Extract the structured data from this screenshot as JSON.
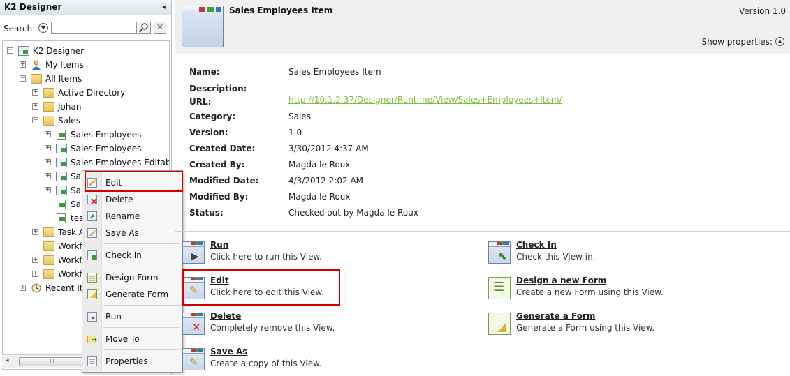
{
  "left": {
    "title": "K2 Designer",
    "collapse_glyph": "◂",
    "search_label": "Search:",
    "search_value": "",
    "search_placeholder": "",
    "clear_glyph": "✕",
    "tree": [
      {
        "label": "K2 Designer",
        "icon": "k2-designer-icon",
        "expander": "⊟"
      },
      {
        "label": "My Items",
        "icon": "user-icon",
        "expander": "+"
      },
      {
        "label": "All Items",
        "icon": "folder-open-icon",
        "expander": "−"
      },
      {
        "label": "Active Directory",
        "icon": "folder-icon",
        "expander": "+"
      },
      {
        "label": "Johan",
        "icon": "folder-icon",
        "expander": "+"
      },
      {
        "label": "Sales",
        "icon": "folder-open-icon",
        "expander": "−"
      },
      {
        "label": "Sales Employees",
        "icon": "smartobject-icon",
        "expander": "+"
      },
      {
        "label": "Sales Employees",
        "icon": "view-icon",
        "expander": "+"
      },
      {
        "label": "Sales Employees Editabl",
        "icon": "view-icon",
        "expander": "+"
      },
      {
        "label": "Sa",
        "icon": "view-icon",
        "expander": "+"
      },
      {
        "label": "Sa",
        "icon": "view-icon",
        "expander": "+"
      },
      {
        "label": "Sa",
        "icon": "document-icon",
        "expander": ""
      },
      {
        "label": "tes",
        "icon": "document-icon",
        "expander": ""
      },
      {
        "label": "Task A",
        "icon": "folder-icon",
        "expander": "+"
      },
      {
        "label": "Workf",
        "icon": "folder-icon",
        "expander": ""
      },
      {
        "label": "Workf",
        "icon": "folder-icon",
        "expander": "+"
      },
      {
        "label": "Workf",
        "icon": "folder-icon",
        "expander": "+"
      },
      {
        "label": "Recent It",
        "icon": "recent-icon",
        "expander": "+"
      }
    ],
    "scroll_arrow": "◂",
    "scroll_grip": "III"
  },
  "context_menu": {
    "items": [
      {
        "label": "Edit",
        "icon": "edit-icon"
      },
      {
        "label": "Delete",
        "icon": "delete-icon"
      },
      {
        "label": "Rename",
        "icon": "rename-icon"
      },
      {
        "label": "Save As",
        "icon": "save-as-icon"
      },
      {
        "label": "Check In",
        "icon": "check-in-icon"
      },
      {
        "label": "Design Form",
        "icon": "design-form-icon"
      },
      {
        "label": "Generate Form",
        "icon": "generate-form-icon"
      },
      {
        "label": "Run",
        "icon": "run-icon"
      },
      {
        "label": "Move To",
        "icon": "move-to-icon"
      },
      {
        "label": "Properties",
        "icon": "properties-icon"
      }
    ]
  },
  "header": {
    "title": "Sales Employees Item",
    "version": "Version 1.0",
    "show_properties": "Show properties:",
    "show_properties_glyph": "▲"
  },
  "properties": {
    "name_label": "Name:",
    "name": "Sales Employees Item",
    "description_label": "Description:",
    "description": "",
    "url_label": "URL:",
    "url": "http://10.1.2.37/Designer/Runtime/View/Sales+Employees+Item/",
    "category_label": "Category:",
    "category": "Sales",
    "version_label": "Version:",
    "version": "1.0",
    "created_date_label": "Created Date:",
    "created_date": "3/30/2012 4:37 AM",
    "created_by_label": "Created By:",
    "created_by": "Magda le Roux",
    "modified_date_label": "Modified Date:",
    "modified_date": "4/3/2012 2:02 AM",
    "modified_by_label": "Modified By:",
    "modified_by": "Magda le Roux",
    "status_label": "Status:",
    "status": "Checked out by Magda le Roux"
  },
  "actions": {
    "run": {
      "title": "Run",
      "desc": "Click here to run this View."
    },
    "edit": {
      "title": "Edit",
      "desc": "Click here to edit this View."
    },
    "delete": {
      "title": "Delete",
      "desc": "Completely remove this View."
    },
    "save_as": {
      "title": "Save As",
      "desc": "Create a copy of this View."
    },
    "check_in": {
      "title": "Check In",
      "desc": "Check this View in."
    },
    "design_form": {
      "title": "Design a new Form",
      "desc": "Create a new Form using this View."
    },
    "generate_form": {
      "title": "Generate a Form",
      "desc": "Generate a Form using this View."
    }
  },
  "colors": {
    "highlight": "#d40000",
    "url": "#7fbf3f",
    "header_bg": "#f0f0f0"
  }
}
